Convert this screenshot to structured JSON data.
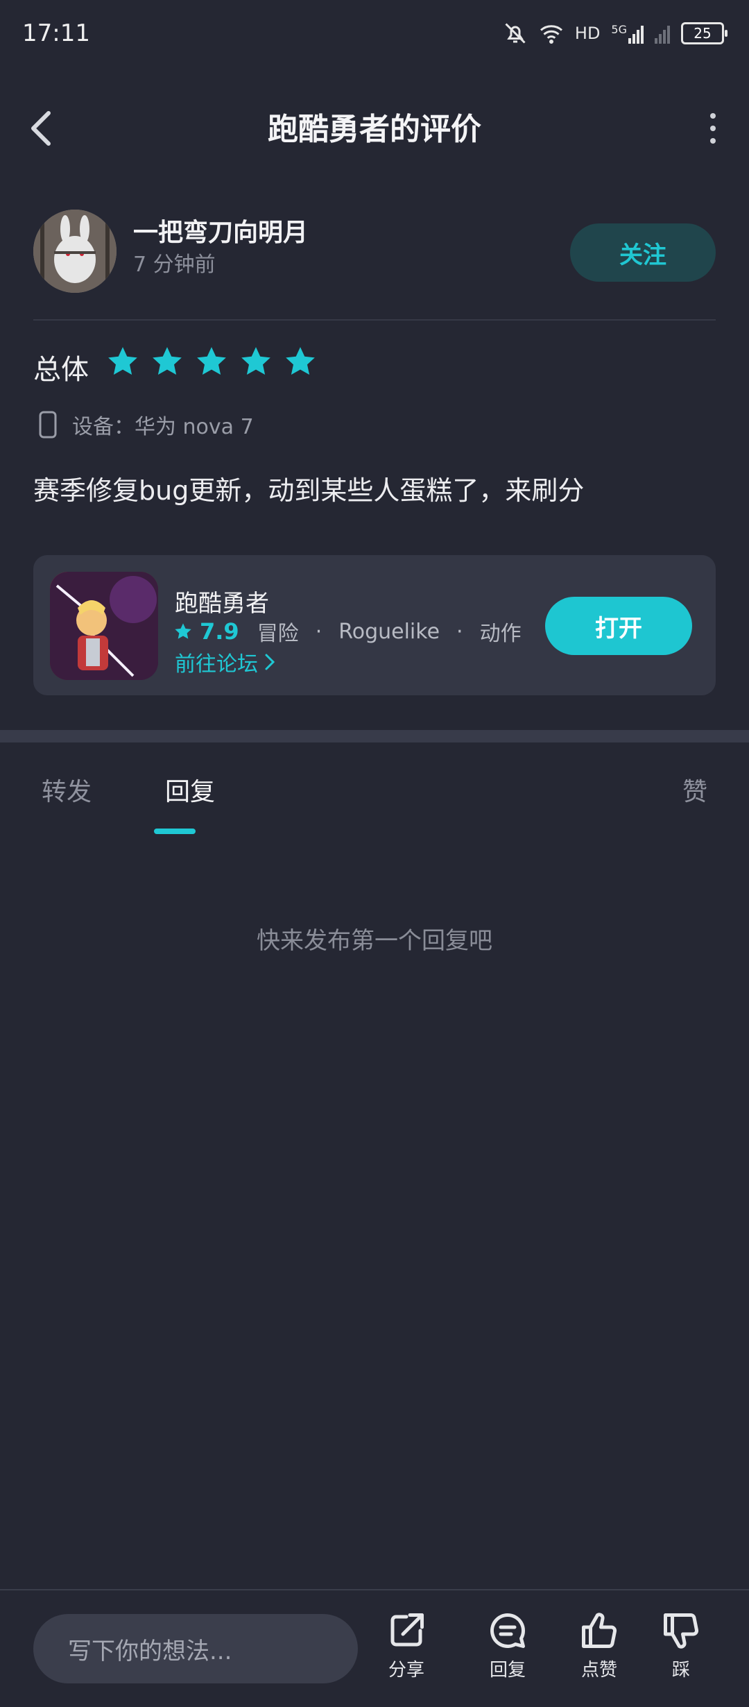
{
  "status_bar": {
    "time": "17:11",
    "battery": "25",
    "network": "HD",
    "signal": "5G"
  },
  "header": {
    "title": "跑酷勇者的评价"
  },
  "author": {
    "name": "一把弯刀向明月",
    "time": "7 分钟前",
    "follow_label": "关注"
  },
  "rating": {
    "label": "总体",
    "stars": 5
  },
  "device": {
    "label": "设备：华为 nova 7"
  },
  "review": {
    "text": "赛季修复bug更新，动到某些人蛋糕了，来刷分"
  },
  "game": {
    "name": "跑酷勇者",
    "score": "7.9",
    "tags": [
      "冒险",
      "Roguelike",
      "动作"
    ],
    "forum_link": "前往论坛",
    "open_label": "打开"
  },
  "tabs": {
    "forward": "转发",
    "reply": "回复",
    "like": "赞"
  },
  "empty_state": "快来发布第一个回复吧",
  "bottom": {
    "input_placeholder": "写下你的想法...",
    "share": "分享",
    "reply": "回复",
    "like": "点赞",
    "dislike": "踩"
  },
  "colors": {
    "accent": "#1fc8d4",
    "background": "#252733",
    "card": "#343745"
  }
}
